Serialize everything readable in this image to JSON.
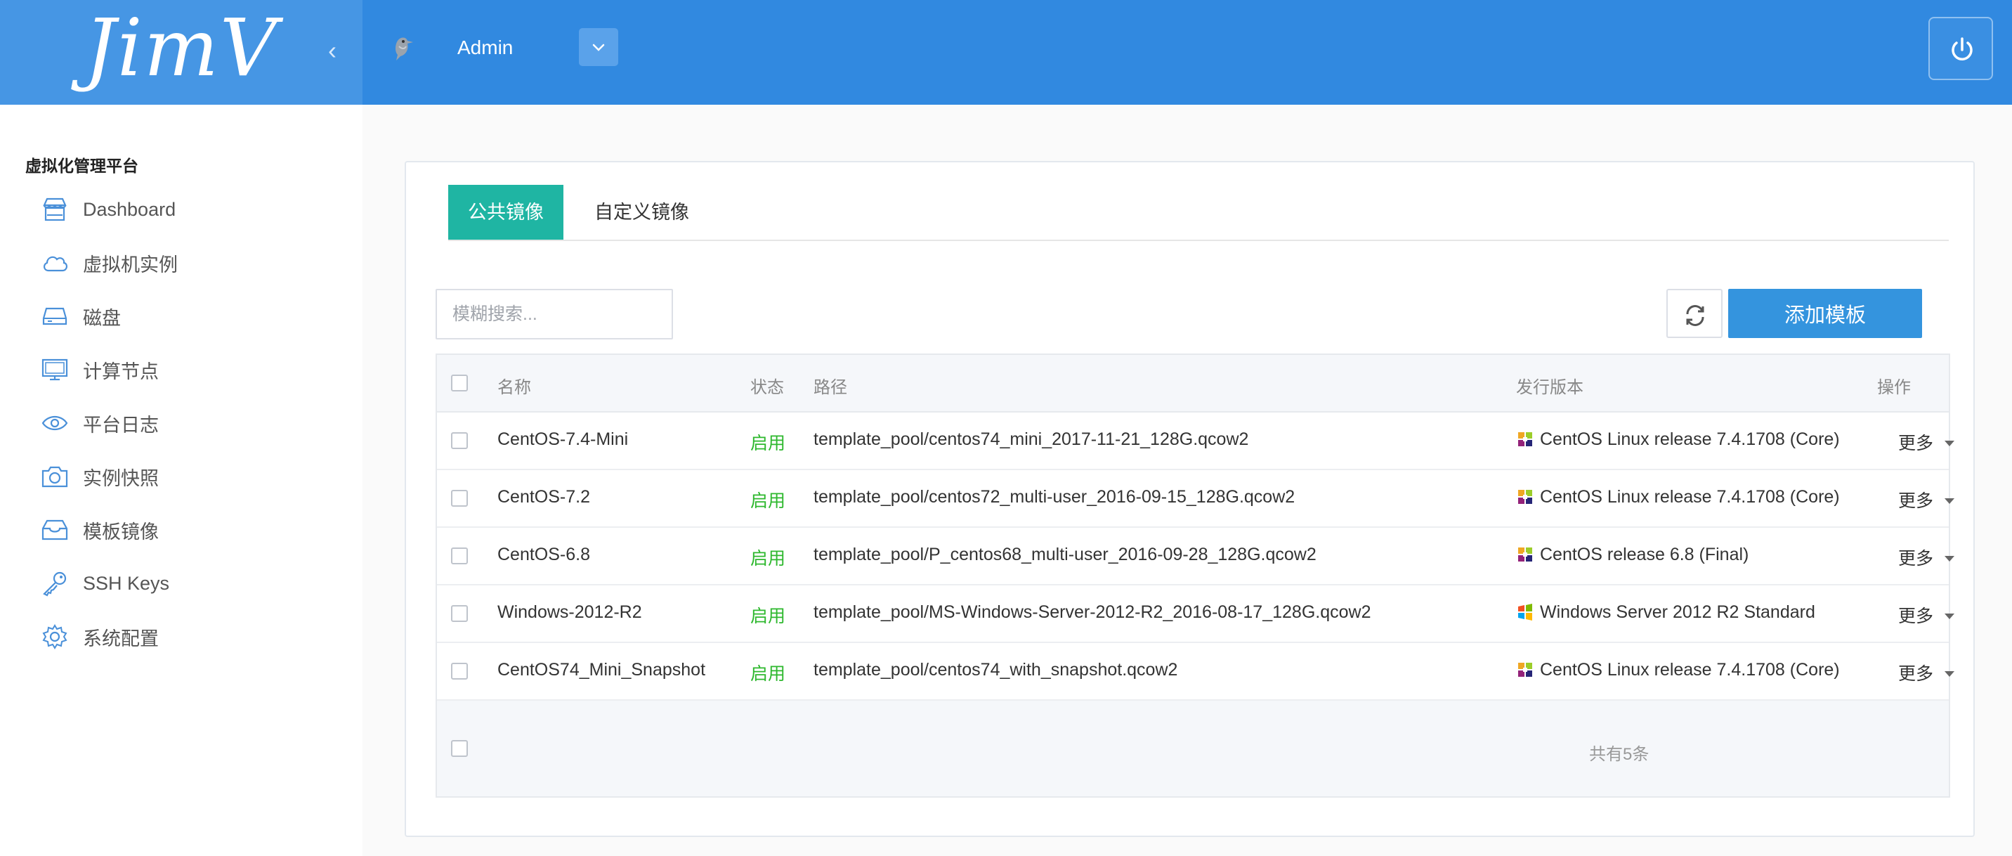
{
  "header": {
    "logo": "JimV",
    "collapse_glyph": "‹",
    "user_name": "Admin",
    "avatar_icon": "bird-avatar-icon",
    "dropdown_icon": "chevron-down-icon",
    "power_icon": "power-icon"
  },
  "sidebar": {
    "title": "虚拟化管理平台",
    "items": [
      {
        "label": "Dashboard",
        "icon": "store-icon"
      },
      {
        "label": "虚拟机实例",
        "icon": "cloud-icon"
      },
      {
        "label": "磁盘",
        "icon": "disk-icon"
      },
      {
        "label": "计算节点",
        "icon": "monitor-icon"
      },
      {
        "label": "平台日志",
        "icon": "eye-icon"
      },
      {
        "label": "实例快照",
        "icon": "camera-icon"
      },
      {
        "label": "模板镜像",
        "icon": "inbox-icon"
      },
      {
        "label": "SSH Keys",
        "icon": "key-icon"
      },
      {
        "label": "系统配置",
        "icon": "gear-icon"
      }
    ]
  },
  "tabs": [
    {
      "label": "公共镜像",
      "active": true
    },
    {
      "label": "自定义镜像",
      "active": false
    }
  ],
  "toolbar": {
    "search_placeholder": "模糊搜索...",
    "search_value": "",
    "add_label": "添加模板"
  },
  "table": {
    "columns": [
      "名称",
      "状态",
      "路径",
      "发行版本",
      "操作"
    ],
    "rows": [
      {
        "name": "CentOS-7.4-Mini",
        "status": "启用",
        "path": "template_pool/centos74_mini_2017-11-21_128G.qcow2",
        "release": "CentOS Linux release 7.4.1708 (Core)",
        "os": "centos",
        "action": "更多"
      },
      {
        "name": "CentOS-7.2",
        "status": "启用",
        "path": "template_pool/centos72_multi-user_2016-09-15_128G.qcow2",
        "release": "CentOS Linux release 7.4.1708 (Core)",
        "os": "centos",
        "action": "更多"
      },
      {
        "name": "CentOS-6.8",
        "status": "启用",
        "path": "template_pool/P_centos68_multi-user_2016-09-28_128G.qcow2",
        "release": "CentOS release 6.8 (Final)",
        "os": "centos",
        "action": "更多"
      },
      {
        "name": "Windows-2012-R2",
        "status": "启用",
        "path": "template_pool/MS-Windows-Server-2012-R2_2016-08-17_128G.qcow2",
        "release": "Windows Server 2012 R2 Standard",
        "os": "windows",
        "action": "更多"
      },
      {
        "name": "CentOS74_Mini_Snapshot",
        "status": "启用",
        "path": "template_pool/centos74_with_snapshot.qcow2",
        "release": "CentOS Linux release 7.4.1708 (Core)",
        "os": "centos",
        "action": "更多"
      }
    ],
    "total": "共有5条"
  },
  "colors": {
    "header": "#3189e0",
    "active_tab": "#1fb5a3",
    "primary_button": "#3494de",
    "status_enabled": "#2eb82e"
  }
}
